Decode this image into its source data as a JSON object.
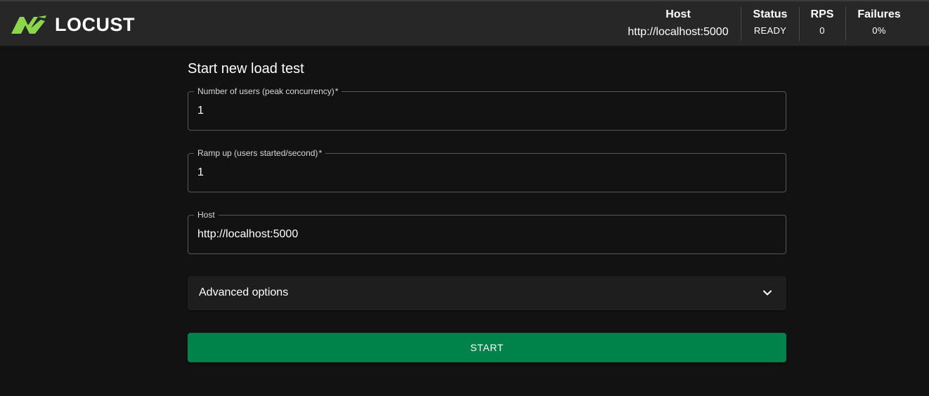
{
  "header": {
    "logo_text": "LOCUST",
    "logo_icon": "locust-grasshopper-icon",
    "brand_color": "#8bd64a",
    "stats": {
      "host_label": "Host",
      "host_value": "http://localhost:5000",
      "status_label": "Status",
      "status_value": "READY",
      "rps_label": "RPS",
      "rps_value": "0",
      "failures_label": "Failures",
      "failures_value": "0%"
    }
  },
  "form": {
    "title": "Start new load test",
    "users": {
      "label": "Number of users (peak concurrency)",
      "required_mark": "*",
      "value": "1"
    },
    "ramp_up": {
      "label": "Ramp up (users started/second)",
      "required_mark": "*",
      "value": "1"
    },
    "host": {
      "label": "Host",
      "value": "http://localhost:5000"
    },
    "advanced": {
      "label": "Advanced options",
      "icon": "chevron-down-icon"
    },
    "start_label": "START",
    "start_color": "#00834a"
  }
}
